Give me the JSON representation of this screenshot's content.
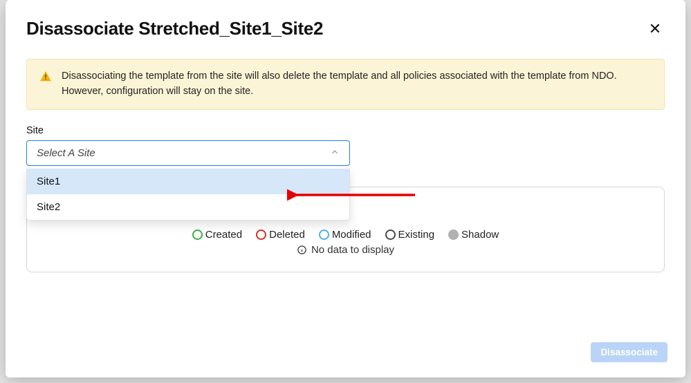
{
  "modal": {
    "title": "Disassociate Stretched_Site1_Site2",
    "close_glyph": "✕"
  },
  "alert": {
    "text": "Disassociating the template from the site will also delete the template and all policies associated with the template from NDO. However, configuration will stay on the site."
  },
  "site_field": {
    "label": "Site",
    "placeholder": "Select A Site",
    "options": [
      "Site1",
      "Site2"
    ]
  },
  "legend": {
    "created": "Created",
    "deleted": "Deleted",
    "modified": "Modified",
    "existing": "Existing",
    "shadow": "Shadow"
  },
  "no_data_text": "No data to display",
  "footer": {
    "disassociate_label": "Disassociate"
  },
  "colors": {
    "created": "#3cb043",
    "deleted": "#d93025",
    "modified": "#4db3e6",
    "existing": "#4a4a4a",
    "shadow": "#b0b0b0"
  }
}
